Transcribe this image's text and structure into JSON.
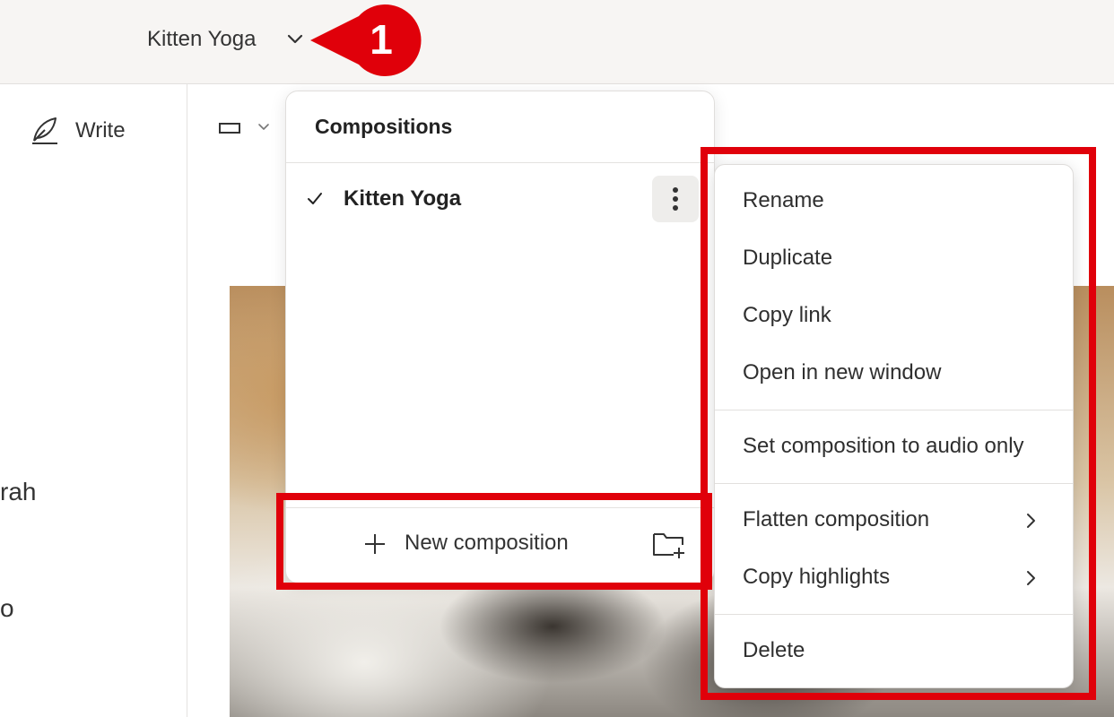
{
  "header": {
    "doc_title": "Kitten Yoga",
    "callout_number": "1",
    "callout_color": "#e0000a"
  },
  "sidebar": {
    "write_label": "Write",
    "write_icon": "feather-pen-icon",
    "partial_text_1": "rah",
    "partial_text_2": "o"
  },
  "compositions": {
    "title": "Compositions",
    "items": [
      {
        "label": "Kitten Yoga",
        "selected": true
      }
    ],
    "new_label": "New composition",
    "new_folder_icon": "new-folder-icon"
  },
  "context_menu": {
    "items": {
      "rename": "Rename",
      "duplicate": "Duplicate",
      "copy_link": "Copy link",
      "open_new_window": "Open in new window",
      "audio_only": "Set composition to audio only",
      "flatten": "Flatten composition",
      "copy_highlights": "Copy highlights",
      "delete": "Delete"
    }
  },
  "highlight_color": "#e0000a"
}
